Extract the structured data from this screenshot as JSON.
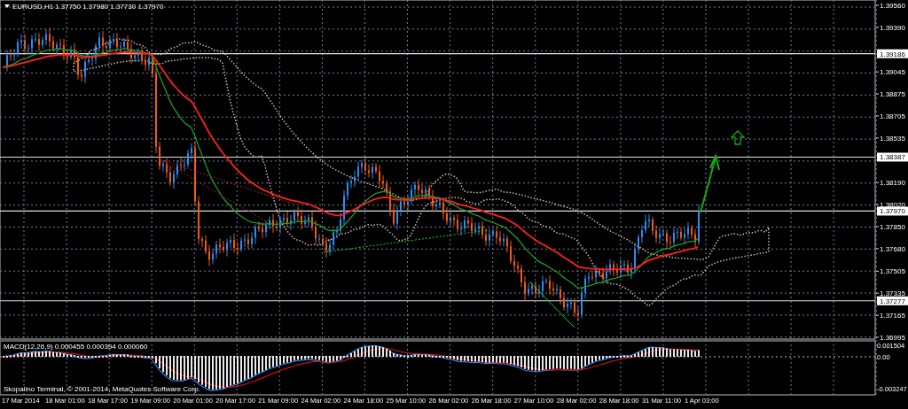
{
  "chart": {
    "symbol": "EURUSD,H1",
    "quote": "1.37750 1.37980 1.37730 1.37970",
    "price_labels": [
      {
        "text": "1.39560",
        "highlighted": false
      },
      {
        "text": "1.39390",
        "highlighted": false
      },
      {
        "text": "1.39186",
        "highlighted": true
      },
      {
        "text": "1.39045",
        "highlighted": false
      },
      {
        "text": "1.38875",
        "highlighted": false
      },
      {
        "text": "1.38705",
        "highlighted": false
      },
      {
        "text": "1.38535",
        "highlighted": false
      },
      {
        "text": "1.38387",
        "highlighted": true
      },
      {
        "text": "1.38190",
        "highlighted": false
      },
      {
        "text": "1.38020",
        "highlighted": false
      },
      {
        "text": "1.37970",
        "highlighted": true
      },
      {
        "text": "1.37850",
        "highlighted": false
      },
      {
        "text": "1.37680",
        "highlighted": false
      },
      {
        "text": "1.37505",
        "highlighted": false
      },
      {
        "text": "1.37335",
        "highlighted": false
      },
      {
        "text": "1.37277",
        "highlighted": true
      },
      {
        "text": "1.37165",
        "highlighted": false
      },
      {
        "text": "1.36995",
        "highlighted": false
      }
    ]
  },
  "macd": {
    "title": "MACD(12,26,9) 0.000455 0.000394 0.000060",
    "scale_labels": [
      "0.001504",
      "0.00",
      "-0.003247"
    ]
  },
  "copyright": "Skopalino Terminal, © 2001-2014, MetaQuotes Software Corp.",
  "time_labels": [
    "17 Mar 2014",
    "18 Mar 01:00",
    "18 Mar 17:00",
    "19 Mar 09:00",
    "20 Mar 01:00",
    "20 Mar 17:00",
    "21 Mar 09:00",
    "24 Mar 02:00",
    "24 Mar 18:00",
    "25 Mar 10:00",
    "26 Mar 02:00",
    "26 Mar 18:00",
    "27 Mar 10:00",
    "28 Mar 02:00",
    "28 Mar 18:00",
    "31 Mar 11:00",
    "1 Apr 03:00"
  ]
}
